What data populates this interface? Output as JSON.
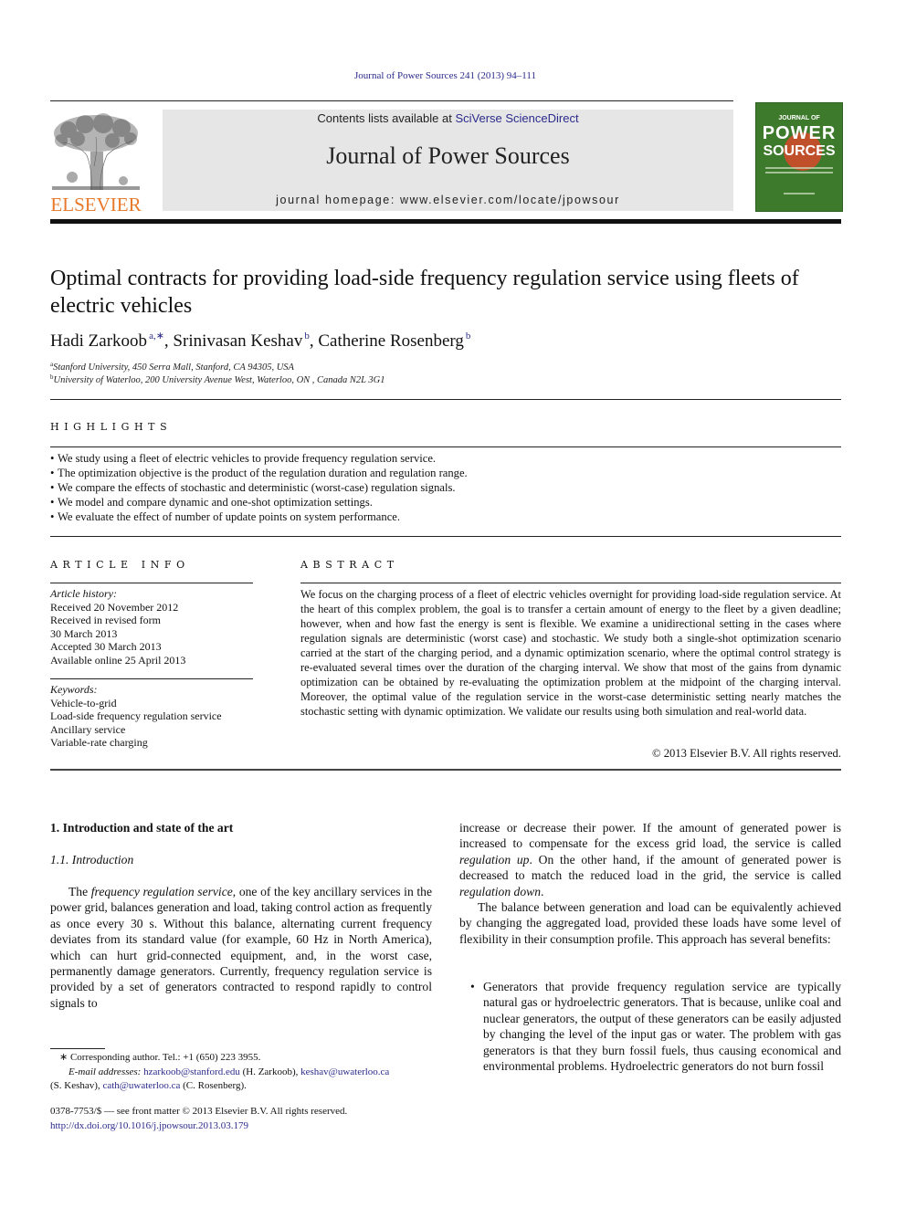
{
  "header": {
    "journal_ref": "Journal of Power Sources 241 (2013) 94–111",
    "contents_prefix": "Contents lists available at ",
    "contents_link": "SciVerse ScienceDirect",
    "journal_name": "Journal of Power Sources",
    "homepage": "journal homepage: www.elsevier.com/locate/jpowsour",
    "publisher_logo_text": "ELSEVIER",
    "cover": {
      "line1": "JOURNAL OF",
      "line2": "POWER",
      "line3": "SOURCES",
      "color": "#3e7a2c"
    }
  },
  "article": {
    "title": "Optimal contracts for providing load-side frequency regulation service using fleets of electric vehicles",
    "authors": [
      {
        "name": "Hadi Zarkoob",
        "sup": "a,∗",
        "sep": ", "
      },
      {
        "name": "Srinivasan Keshav",
        "sup": "b",
        "sep": ", "
      },
      {
        "name": "Catherine Rosenberg",
        "sup": "b",
        "sep": ""
      }
    ],
    "affiliations": [
      {
        "mark": "a",
        "text": "Stanford University, 450 Serra Mall, Stanford, CA 94305, USA"
      },
      {
        "mark": "b",
        "text": "University of Waterloo, 200 University Avenue West, Waterloo, ON , Canada N2L 3G1"
      }
    ]
  },
  "highlights": {
    "heading": "HIGHLIGHTS",
    "items": [
      "We study using a fleet of electric vehicles to provide frequency regulation service.",
      "The optimization objective is the product of the regulation duration and regulation range.",
      "We compare the effects of stochastic and deterministic (worst-case) regulation signals.",
      "We model and compare dynamic and one-shot optimization settings.",
      "We evaluate the effect of number of update points on system performance."
    ]
  },
  "article_info": {
    "heading": "ARTICLE INFO",
    "history_label": "Article history:",
    "history": [
      "Received 20 November 2012",
      "Received in revised form",
      "30 March 2013",
      "Accepted 30 March 2013",
      "Available online 25 April 2013"
    ],
    "keywords_label": "Keywords:",
    "keywords": [
      "Vehicle-to-grid",
      "Load-side frequency regulation service",
      "Ancillary service",
      "Variable-rate charging"
    ]
  },
  "abstract": {
    "heading": "ABSTRACT",
    "text": "We focus on the charging process of a fleet of electric vehicles overnight for providing load-side regulation service. At the heart of this complex problem, the goal is to transfer a certain amount of energy to the fleet by a given deadline; however, when and how fast the energy is sent is flexible. We examine a unidirectional setting in the cases where regulation signals are deterministic (worst case) and stochastic. We study both a single-shot optimization scenario carried at the start of the charging period, and a dynamic optimization scenario, where the optimal control strategy is re-evaluated several times over the duration of the charging interval. We show that most of the gains from dynamic optimization can be obtained by re-evaluating the optimization problem at the midpoint of the charging interval. Moreover, the optimal value of the regulation service in the worst-case deterministic setting nearly matches the stochastic setting with dynamic optimization. We validate our results using both simulation and real-world data.",
    "copyright": "© 2013 Elsevier B.V. All rights reserved."
  },
  "body": {
    "section_heading": "1.  Introduction and state of the art",
    "subsection_heading": "1.1.  Introduction",
    "left_para": {
      "p1_pre": "The ",
      "p1_em": "frequency regulation service",
      "p1_post": ", one of the key ancillary services in the power grid, balances generation and load, taking control action as frequently as once every 30 s. Without this balance, alternating current frequency deviates from its standard value (for example, 60 Hz in North America), which can hurt grid-connected equipment, and, in the worst case, permanently damage generators. Currently, frequency regulation service is provided by a set of generators contracted to respond rapidly to control signals to"
    },
    "right_para1": {
      "a": "increase or decrease their power. If the amount of generated power is increased to compensate for the excess grid load, the service is called ",
      "em1": "regulation up",
      "b": ". On the other hand, if the amount of generated power is decreased to match the reduced load in the grid, the service is called ",
      "em2": "regulation down",
      "c": "."
    },
    "right_para2": "The balance between generation and load can be equivalently achieved by changing the aggregated load, provided these loads have some level of flexibility in their consumption profile. This approach has several benefits:",
    "bullet1": "Generators that provide frequency regulation service are typically natural gas or hydroelectric generators. That is because, unlike coal and nuclear generators, the output of these generators can be easily adjusted by changing the level of the input gas or water. The problem with gas generators is that they burn fossil fuels, thus causing economical and environmental problems. Hydroelectric generators do not burn fossil"
  },
  "footnotes": {
    "corresponding": "∗  Corresponding author. Tel.: +1 (650) 223 3955.",
    "email_label": "E-mail addresses:",
    "emails": [
      {
        "addr": "hzarkoob@stanford.edu",
        "who": " (H. Zarkoob), "
      },
      {
        "addr": "keshav@uwaterloo.ca",
        "who": ""
      },
      {
        "addr": "cath@uwaterloo.ca",
        "who": " (C. Rosenberg)."
      }
    ],
    "keshav_who": "(S. Keshav), ",
    "front_matter": "0378-7753/$ — see front matter © 2013 Elsevier B.V. All rights reserved.",
    "doi": "http://dx.doi.org/10.1016/j.jpowsour.2013.03.179"
  }
}
